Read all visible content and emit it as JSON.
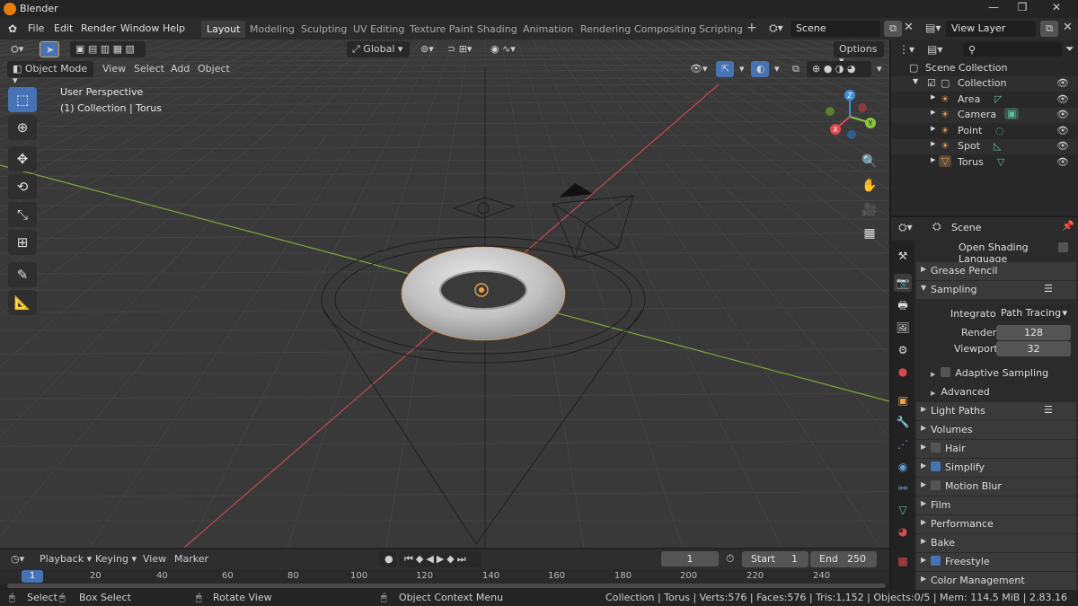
{
  "window": {
    "title": "Blender",
    "controls": [
      "—",
      "❐",
      "✕"
    ]
  },
  "menu": [
    "File",
    "Edit",
    "Render",
    "Window",
    "Help"
  ],
  "workspaces": [
    "Layout",
    "Modeling",
    "Sculpting",
    "UV Editing",
    "Texture Paint",
    "Shading",
    "Animation",
    "Rendering",
    "Compositing",
    "Scripting"
  ],
  "active_workspace": "Layout",
  "scene_name": "Scene",
  "view_layer": "View Layer",
  "viewport": {
    "mode": "Object Mode",
    "menus": [
      "View",
      "Select",
      "Add",
      "Object"
    ],
    "transform_orientation": "Global",
    "options_label": "Options",
    "overlay_text_1": "User Perspective",
    "overlay_text_2": "(1) Collection | Torus",
    "gizmo_axes": {
      "x": "X",
      "y": "Y",
      "z": "Z"
    },
    "colors": {
      "x_axis": "#e0484f",
      "y_axis": "#8cc43c",
      "z_axis": "#3d8fd9",
      "grid": "#444444",
      "background": "#393939"
    }
  },
  "outliner": {
    "root": "Scene Collection",
    "collection": "Collection",
    "items": [
      "Area",
      "Camera",
      "Point",
      "Spot",
      "Torus"
    ]
  },
  "properties": {
    "context": "Scene",
    "open_shading_language": "Open Shading Language",
    "panels": {
      "grease_pencil": "Grease Pencil",
      "sampling": "Sampling",
      "integrator_label": "Integrator",
      "integrator_value": "Path Tracing",
      "render_label": "Render",
      "render_value": "128",
      "viewport_label": "Viewport",
      "viewport_value": "32",
      "adaptive_sampling": "Adaptive Sampling",
      "advanced": "Advanced",
      "light_paths": "Light Paths",
      "volumes": "Volumes",
      "hair": "Hair",
      "simplify": "Simplify",
      "motion_blur": "Motion Blur",
      "film": "Film",
      "performance": "Performance",
      "bake": "Bake",
      "freestyle": "Freestyle",
      "color_management": "Color Management"
    }
  },
  "timeline": {
    "menus": [
      "Playback",
      "Keying",
      "View",
      "Marker"
    ],
    "current_frame": "1",
    "start_label": "Start",
    "start_value": "1",
    "end_label": "End",
    "end_value": "250",
    "ruler": [
      "1",
      "20",
      "40",
      "60",
      "80",
      "100",
      "120",
      "140",
      "160",
      "180",
      "200",
      "220",
      "240"
    ]
  },
  "status": {
    "select": "Select",
    "box_select": "Box Select",
    "rotate_view": "Rotate View",
    "context_menu": "Object Context Menu",
    "stats": "Collection | Torus | Verts:576 | Faces:576 | Tris:1,152 | Objects:0/5 | Mem: 114.5 MiB | 2.83.16"
  }
}
